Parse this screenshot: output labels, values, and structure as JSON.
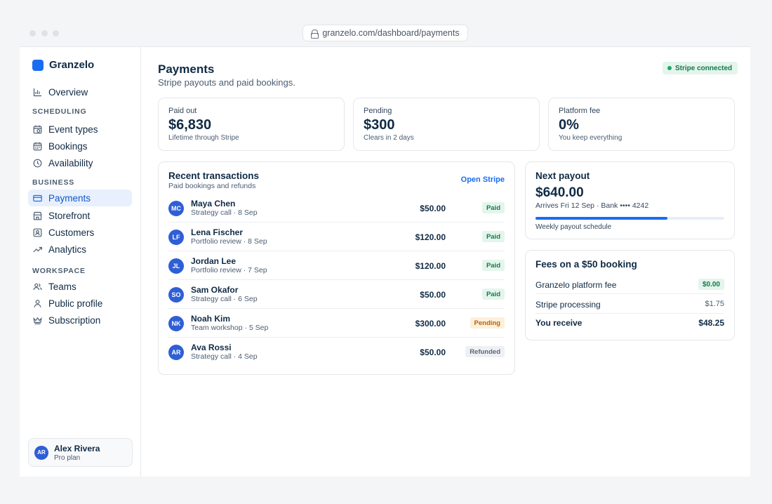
{
  "browser": {
    "url": "granzelo.com/dashboard/payments"
  },
  "brand": {
    "name": "Granzelo"
  },
  "sidebar": {
    "overview": {
      "label": "Overview",
      "icon": "bar-chart-icon"
    },
    "sections": {
      "scheduling": "SCHEDULING",
      "business": "BUSINESS",
      "workspace": "WORKSPACE"
    },
    "items": [
      {
        "label": "Event types",
        "icon": "calendar-clock-icon"
      },
      {
        "label": "Bookings",
        "icon": "calendar-icon"
      },
      {
        "label": "Availability",
        "icon": "clock-icon"
      },
      {
        "label": "Payments",
        "icon": "credit-card-icon",
        "active": true
      },
      {
        "label": "Storefront",
        "icon": "storefront-icon"
      },
      {
        "label": "Customers",
        "icon": "contact-card-icon"
      },
      {
        "label": "Analytics",
        "icon": "trend-up-icon"
      },
      {
        "label": "Teams",
        "icon": "users-icon"
      },
      {
        "label": "Public profile",
        "icon": "user-icon"
      },
      {
        "label": "Subscription",
        "icon": "crown-icon"
      }
    ],
    "user": {
      "initials": "AR",
      "name": "Alex Rivera",
      "plan": "Pro plan"
    }
  },
  "header": {
    "title": "Payments",
    "subtitle": "Stripe payouts and paid bookings.",
    "status_badge": "Stripe connected"
  },
  "stats": [
    {
      "label": "Paid out",
      "value": "$6,830",
      "sub": "Lifetime through Stripe"
    },
    {
      "label": "Pending",
      "value": "$300",
      "sub": "Clears in 2 days"
    },
    {
      "label": "Platform fee",
      "value": "0%",
      "sub": "You keep everything"
    }
  ],
  "transactions": {
    "title": "Recent transactions",
    "subtitle": "Paid bookings and refunds",
    "action": "Open Stripe",
    "rows": [
      {
        "initials": "MC",
        "name": "Maya Chen",
        "meta": "Strategy call · 8 Sep",
        "amount": "$50.00",
        "status": "Paid"
      },
      {
        "initials": "LF",
        "name": "Lena Fischer",
        "meta": "Portfolio review · 8 Sep",
        "amount": "$120.00",
        "status": "Paid"
      },
      {
        "initials": "JL",
        "name": "Jordan Lee",
        "meta": "Portfolio review · 7 Sep",
        "amount": "$120.00",
        "status": "Paid"
      },
      {
        "initials": "SO",
        "name": "Sam Okafor",
        "meta": "Strategy call · 6 Sep",
        "amount": "$50.00",
        "status": "Paid"
      },
      {
        "initials": "NK",
        "name": "Noah Kim",
        "meta": "Team workshop · 5 Sep",
        "amount": "$300.00",
        "status": "Pending"
      },
      {
        "initials": "AR",
        "name": "Ava Rossi",
        "meta": "Strategy call · 4 Sep",
        "amount": "$50.00",
        "status": "Refunded"
      }
    ]
  },
  "payout": {
    "title": "Next payout",
    "amount": "$640.00",
    "arrival": "Arrives Fri 12 Sep · Bank •••• 4242",
    "progress": 0.7,
    "note": "Weekly payout schedule"
  },
  "fees": {
    "title": "Fees on a $50 booking",
    "rows": [
      {
        "label": "Granzelo platform fee",
        "value": "$0.00"
      },
      {
        "label": "Stripe processing",
        "value": "$1.75"
      },
      {
        "label": "You receive",
        "value": "$48.25"
      }
    ]
  },
  "colors": {
    "accent": "#1a6cf0",
    "navy": "#0f2a44",
    "paid": "#17784a",
    "pending": "#b86114",
    "refunded": "#5b6878"
  }
}
